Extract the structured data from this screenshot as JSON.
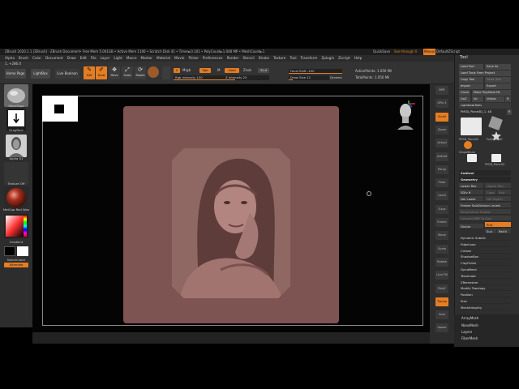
{
  "titlebar": {
    "app_title": "ZBrush 2020.1.1 [ZBrush] · ZBrush Document",
    "mem_info": "• Free Mem 5.001GB • Active Mem 1100 • Scratch Disk 41 • Timer►0.101 • PolyCount►1.048 MP • MeshCount►1",
    "quicksave": "QuickSave",
    "see_through": "See-through 0",
    "menus": "Menus",
    "default_script": "DefaultZScript"
  },
  "menubar": {
    "items": [
      "Alpha",
      "Brush",
      "Color",
      "Document",
      "Draw",
      "Edit",
      "File",
      "Layer",
      "Light",
      "Macro",
      "Marker",
      "Material",
      "Movie",
      "Picker",
      "Preferences",
      "Render",
      "Stencil",
      "Stroke",
      "Texture",
      "Tool",
      "Transform",
      "Zplugin",
      "Zscript",
      "Help"
    ]
  },
  "toolbar": {
    "zoom_readout": "1, +286.0",
    "home_page": "Home Page",
    "lightbox": "LightBox",
    "live_boolean": "Live Boolean",
    "edit": "Edit",
    "draw": "Draw",
    "move": "Move",
    "scale": "Scale",
    "rotate": "Rotate",
    "a_label": "A",
    "mrgb": "Mrgb",
    "rgb": "Rgb",
    "m": "M",
    "zadd": "Zadd",
    "zsub": "Zsub",
    "zcut": "Zcut",
    "rgb_intensity": "Rgb Intensity 100",
    "z_intensity": "Z Intensity 25",
    "focal_shift": "Focal Shift -100",
    "draw_size": "Draw Size 12",
    "dynamic": "Dynamic",
    "active_points": "ActivePoints: 1.050 Mil",
    "total_points": "TotalPoints: 1.050 Mil"
  },
  "left_shelf": {
    "brush_label": "MoveTopo",
    "stroke_label": "DragRect",
    "alpha_label": "Alpha 01",
    "texture_label": "Texture Off",
    "material_label": "MatCap Red Wax",
    "gradient_label": "Gradient",
    "switch_label": "SwitchColor",
    "alternate_label": "Alternate"
  },
  "right_shelf": {
    "items": [
      "BPR",
      "SPix 3",
      "Scroll",
      "Zoom",
      "Actual",
      "AAHalf",
      "Persp",
      "Floor",
      "Local",
      "Gxyz",
      "Frame",
      "Move",
      "Scale",
      "Rotate",
      "Line Fill",
      "PolyF",
      "Transp",
      "Solo",
      "Xpose"
    ]
  },
  "tool_panel": {
    "title": "Tool",
    "load_tool": "Load Tool",
    "save_as": "Save As",
    "load_from_project": "Load Tools From Project",
    "copy_tool": "Copy Tool",
    "paste_tool": "Paste Tool",
    "import": "Import",
    "export": "Export",
    "clone": "Clone",
    "make_polymesh": "Make PolyMesh3D",
    "goz": "GoZ",
    "all": "All",
    "visible": "Visible",
    "r": "R",
    "lightbox_tools": "Lightbox▸Tools",
    "current_tool": "PM3D_Plane3D_1. 48",
    "r_btn": "R",
    "thumbs": [
      "PM3D_Plane3D",
      "PolyMesh3D",
      "SimpleBrush",
      "PM3D_Plane3D"
    ],
    "subtools": [
      "Subtool",
      "Geometry",
      "Lower Res",
      "Higher Res",
      "SDiv 6",
      "Cage",
      "Rstr",
      "Del Lower",
      "Del Higher",
      "Freeze SubDivision Levels",
      "Reconstruct Subdiv",
      "Convert BPR To Geo",
      "Divide",
      "Smt",
      "Suv",
      "ReUV",
      "Dynamic Subdiv",
      "EdgeLoop",
      "Crease",
      "ShadowBox",
      "ClayPolish",
      "DynaMesh",
      "Tessimate",
      "ZRemesher",
      "Modify Topology",
      "Position",
      "Size",
      "MeshIntegrity"
    ],
    "bottom": [
      "ArrayMesh",
      "NanoMesh",
      "Layers",
      "FiberMesh"
    ]
  },
  "colors": {
    "accent": "#e57d22",
    "panel": "#2f2f2f",
    "document_bg": "#7e5452",
    "portrait_tint": "#8f6763"
  }
}
